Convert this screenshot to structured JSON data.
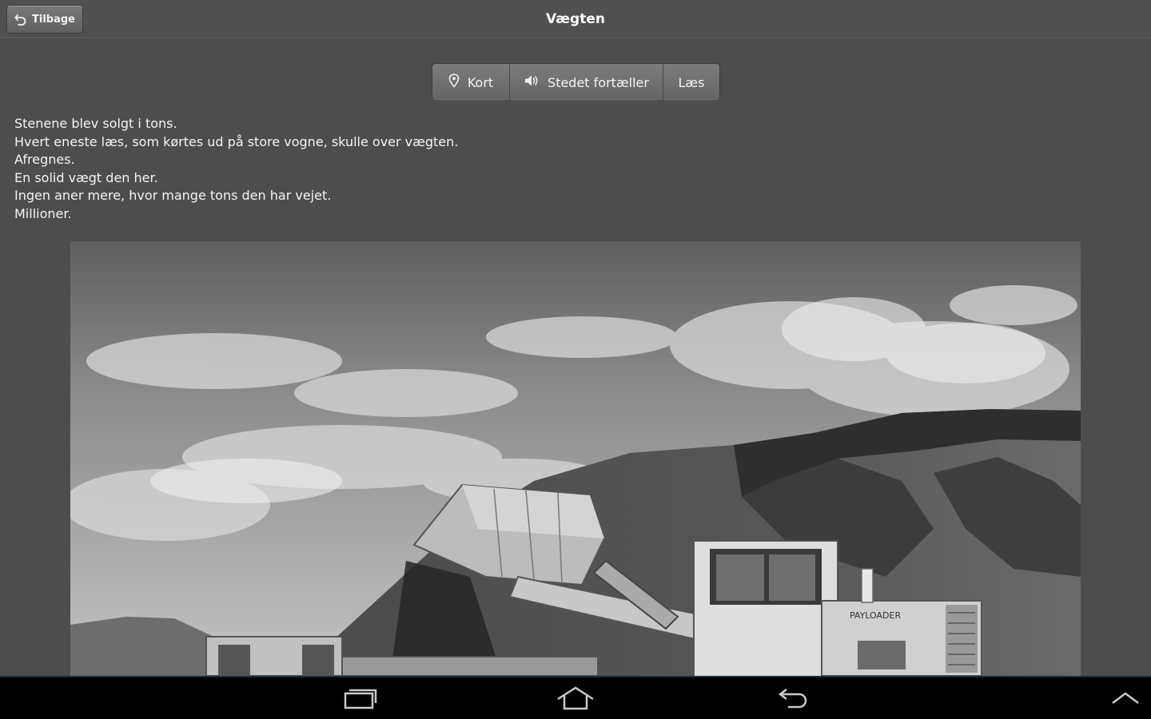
{
  "header": {
    "back_label": "Tilbage",
    "title": "Vægten"
  },
  "tabs": [
    {
      "label": "Kort",
      "icon": "map-pin-icon"
    },
    {
      "label": "Stedet fortæller",
      "icon": "speaker-icon"
    },
    {
      "label": "Læs",
      "icon": ""
    }
  ],
  "content": {
    "lines": [
      "Stenene blev solgt i tons.",
      "Hvert eneste læs, som kørtes ud på store vogne, skulle over vægten.",
      "Afregnes.",
      "En solid vægt den her.",
      "Ingen aner mere, hvor mange tons den har vejet.",
      "Millioner."
    ],
    "photo": {
      "alt": "black-and-white photo of a wheel loader dumping gravel onto a truck",
      "loader_text": "PAYLOADER"
    }
  },
  "navbar": {
    "icons": [
      "recent-apps-icon",
      "home-icon",
      "back-nav-icon",
      "menu-up-icon"
    ]
  },
  "colors": {
    "background": "#4d4d4d",
    "button": "#6e6e6e",
    "navbar": "#000000"
  }
}
